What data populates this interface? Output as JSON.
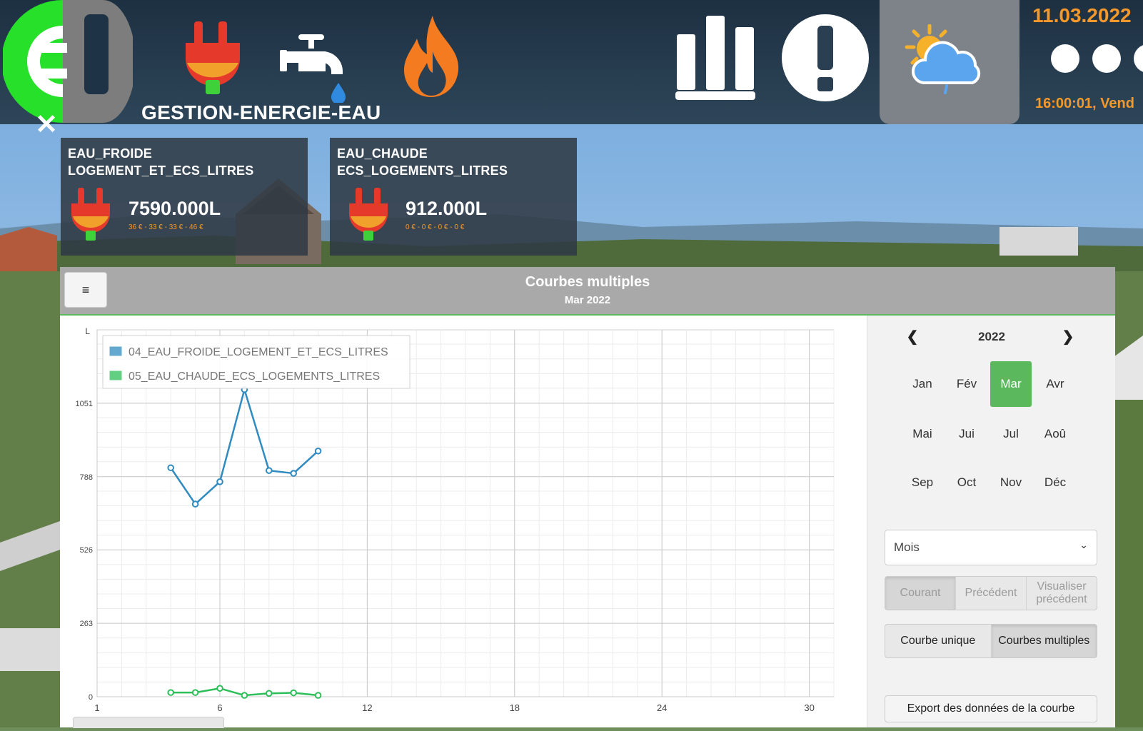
{
  "header": {
    "app_title": "GESTION-ENERGIE-EAU",
    "date": "11.03.2022",
    "time": "16:00:01, Vend",
    "close_symbol": "✕",
    "icons": [
      "logo-icon",
      "plug-icon",
      "water-tap-icon",
      "flame-icon",
      "bar-chart-icon",
      "alert-icon",
      "weather-icon",
      "more-dots-icon"
    ]
  },
  "cards": [
    {
      "title_line1": "EAU_FROIDE",
      "title_line2": "LOGEMENT_ET_ECS_LITRES",
      "value": "7590.000L",
      "costs": "36 € - 33 € - 33 € - 46 €"
    },
    {
      "title_line1": "EAU_CHAUDE",
      "title_line2": "ECS_LOGEMENTS_LITRES",
      "value": "912.000L",
      "costs": "0 € - 0 € - 0 € - 0 €"
    }
  ],
  "panel": {
    "menu_symbol": "≡",
    "title": "Courbes multiples",
    "subtitle": "Mar 2022"
  },
  "sidebar": {
    "year": "2022",
    "prev_symbol": "❮",
    "next_symbol": "❯",
    "months": [
      "Jan",
      "Fév",
      "Mar",
      "Avr",
      "Mai",
      "Jui",
      "Jul",
      "Aoû",
      "Sep",
      "Oct",
      "Nov",
      "Déc"
    ],
    "active_month_index": 2,
    "period_value": "Mois",
    "period_buttons": [
      "Courant",
      "Précédent",
      "Visualiser précédent"
    ],
    "mode_buttons": [
      "Courbe unique",
      "Courbes multiples"
    ],
    "export_label": "Export des données de la courbe"
  },
  "colors": {
    "accent_green": "#5cb85c",
    "orange": "#f4982b",
    "series_blue": "#2f8bc0",
    "series_green": "#2fbf5a"
  },
  "chart_data": {
    "type": "line",
    "ylabel": "L",
    "xlim": [
      1,
      31
    ],
    "ylim": [
      0,
      1314
    ],
    "x_ticks": [
      1,
      6,
      12,
      18,
      24,
      30
    ],
    "y_ticks": [
      0,
      263,
      526,
      788,
      1051
    ],
    "grid": true,
    "legend_position": "top-left",
    "series": [
      {
        "name": "04_EAU_FROIDE_LOGEMENT_ET_ECS_LITRES",
        "color": "#2f8bc0",
        "x": [
          4,
          5,
          6,
          7,
          8,
          9,
          10
        ],
        "y": [
          820,
          690,
          770,
          1100,
          810,
          800,
          880
        ]
      },
      {
        "name": "05_EAU_CHAUDE_ECS_LOGEMENTS_LITRES",
        "color": "#2fbf5a",
        "x": [
          4,
          5,
          6,
          7,
          8,
          9,
          10
        ],
        "y": [
          15,
          15,
          30,
          5,
          12,
          14,
          5
        ]
      }
    ]
  }
}
